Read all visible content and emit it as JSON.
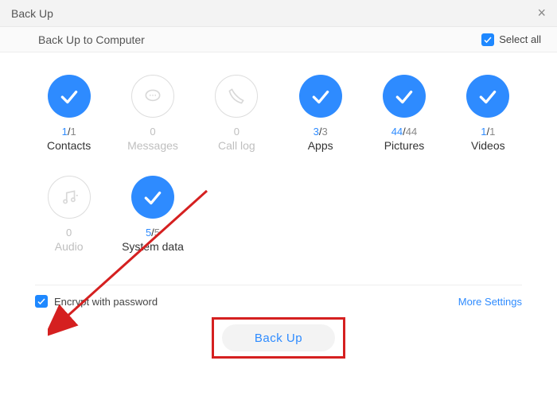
{
  "window": {
    "title": "Back Up",
    "subtitle": "Back Up to Computer",
    "select_all_label": "Select all"
  },
  "items": [
    {
      "key": "contacts",
      "label": "Contacts",
      "current": "1",
      "total": "1",
      "selected": true,
      "icon": "check"
    },
    {
      "key": "messages",
      "label": "Messages",
      "current": "0",
      "total": "",
      "selected": false,
      "icon": "chat"
    },
    {
      "key": "calllog",
      "label": "Call log",
      "current": "0",
      "total": "",
      "selected": false,
      "icon": "phone"
    },
    {
      "key": "apps",
      "label": "Apps",
      "current": "3",
      "total": "3",
      "selected": true,
      "icon": "check"
    },
    {
      "key": "pictures",
      "label": "Pictures",
      "current": "44",
      "total": "44",
      "selected": true,
      "icon": "check"
    },
    {
      "key": "videos",
      "label": "Videos",
      "current": "1",
      "total": "1",
      "selected": true,
      "icon": "check"
    },
    {
      "key": "audio",
      "label": "Audio",
      "current": "0",
      "total": "",
      "selected": false,
      "icon": "music"
    },
    {
      "key": "systemdata",
      "label": "System data",
      "current": "5",
      "total": "5",
      "selected": true,
      "icon": "check"
    }
  ],
  "footer": {
    "encrypt_label": "Encrypt with password",
    "encrypt_checked": true,
    "more_settings_label": "More Settings",
    "backup_button_label": "Back Up"
  },
  "colors": {
    "accent": "#2e8bff",
    "annotation": "#d52020"
  }
}
